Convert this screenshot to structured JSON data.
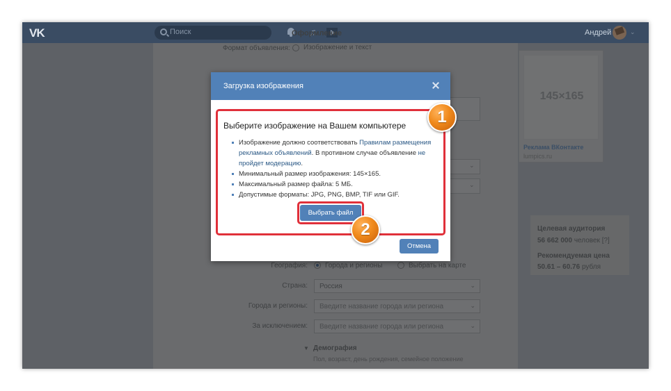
{
  "topbar": {
    "logo": "VK",
    "search_placeholder": "Поиск",
    "user_name": "Андрей"
  },
  "form": {
    "section_title": "Оформление",
    "format_label": "Формат объявления:",
    "format_value": "Изображение и текст",
    "geo_label": "География:",
    "geo_option_1": "Города и регионы",
    "geo_option_2": "Выбрать на карте",
    "country_label": "Страна:",
    "country_value": "Россия",
    "cities_label": "Города и регионы:",
    "cities_placeholder": "Введите название города или региона",
    "exclude_label": "За исключением:",
    "exclude_placeholder": "Введите название города или региона",
    "demography_title": "Демография",
    "demography_sub": "Пол, возраст, день рождения, семейное положение"
  },
  "ad_preview": {
    "size": "145×165",
    "title": "Реклама ВКонтакте",
    "site": "lumpics.ru"
  },
  "audience": {
    "title": "Целевая аудитория",
    "count": "56 662 000",
    "count_suffix": "человек [?]",
    "price_title": "Рекомендуемая цена",
    "price_value": "50.61 – 60.76",
    "price_suffix": "рубля"
  },
  "modal": {
    "title": "Загрузка изображения",
    "heading": "Выберите изображение на Вашем компьютере",
    "rule1_text": "Изображение должно соответствовать ",
    "rule1_link": "Правилам размещения рекламных объявлений",
    "rule1_mid": ". В противном случае объявление ",
    "rule1_link2": "не пройдет модерацию",
    "rule1_end": ".",
    "rule2": "Минимальный размер изображения: 145×165.",
    "rule3": "Максимальный размер файла: 5 МБ.",
    "rule4": "Допустимые форматы: JPG, PNG, BMP, TIF или GIF.",
    "choose_file": "Выбрать файл",
    "cancel": "Отмена"
  },
  "annotations": {
    "badge1": "1",
    "badge2": "2"
  }
}
